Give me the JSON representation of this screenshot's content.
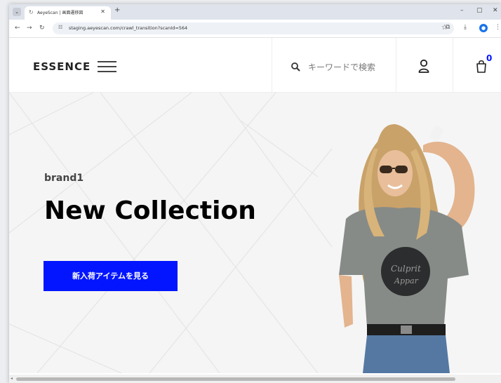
{
  "browser": {
    "tab_title": "AeyeScan | 画面遷移図",
    "url": "staging.aeyescan.com/crawl_transition?scanId=564",
    "icons": {
      "tab_menu": "chevron-down-icon",
      "close": "close-icon",
      "new_tab": "plus-icon",
      "back": "back-arrow-icon",
      "forward": "forward-arrow-icon",
      "reload": "reload-icon",
      "bookmark": "star-icon",
      "extensions": "puzzle-icon",
      "download": "download-icon",
      "profile": "profile-icon",
      "menu": "kebab-menu-icon"
    }
  },
  "site": {
    "logo": "ESSENCE",
    "search_placeholder": "キーワードで検索",
    "cart_count": "0",
    "accent_color": "#0315ff"
  },
  "hero": {
    "brand": "brand1",
    "title": "New Collection",
    "button_label": "新入荷アイテムを見る",
    "image": "woman-in-grey-tshirt-photo"
  }
}
